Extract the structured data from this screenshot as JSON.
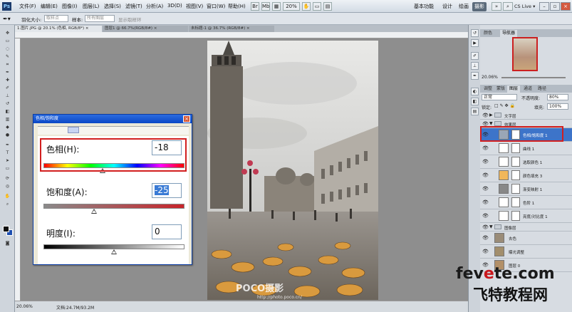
{
  "app": {
    "logo": "Ps"
  },
  "menu": [
    "文件(F)",
    "编辑(E)",
    "图像(I)",
    "图层(L)",
    "选择(S)",
    "滤镜(T)",
    "分析(A)",
    "3D(D)",
    "视图(V)",
    "窗口(W)",
    "帮助(H)"
  ],
  "menu_icons": [
    "Br",
    "Mb",
    "▦",
    "20%",
    "✋",
    "▭",
    "▤"
  ],
  "workspaces": [
    "基本功能",
    "设计",
    "绘画",
    "摄影"
  ],
  "cslive": "CS Live ▾",
  "options": {
    "feather_label": "羽化大小:",
    "feather_value": "取样点",
    "sample_label": "样本:",
    "sample_value": "所有图层",
    "show_ring": "显示取样环"
  },
  "tabs": [
    "1.图片.JPG @ 20.1% (色相, RGB/8*) ×",
    "图层1 @ 66.7%(RGB/8#) ×",
    "未标题-1 @ 36.7% (RGB/8#) ×"
  ],
  "status": {
    "zoom": "20.06%",
    "doc": "文档:24.7M/93.2M"
  },
  "photo": {
    "watermark": "POCO摄影",
    "watermark_url": "http://photo.poco.cn/"
  },
  "dialog": {
    "title": "色相/饱和度",
    "close": "×",
    "hue_label": "色相(H):",
    "hue_value": "-18",
    "sat_label": "饱和度(A):",
    "sat_value": "-25",
    "light_label": "明度(I):",
    "light_value": "0",
    "hue_pos": 0.42,
    "sat_pos": 0.36,
    "light_pos": 0.5
  },
  "right_tabs": {
    "top": [
      "颜色",
      "导航器"
    ],
    "mid": [
      "调整",
      "蒙版",
      "图层",
      "通道",
      "路径"
    ]
  },
  "navigator": {
    "zoom": "20.06%"
  },
  "layers_panel": {
    "blend_mode": "正常",
    "opacity_label": "不透明度:",
    "opacity_value": "80%",
    "lock_label": "锁定:",
    "fill_label": "填充:",
    "fill_value": "100%"
  },
  "layers": [
    {
      "name": "文字层",
      "type": "group"
    },
    {
      "name": "效果层",
      "type": "group"
    },
    {
      "name": "色相/饱和度 1",
      "type": "adj",
      "selected": true,
      "thumb_color": "#9aa6b6"
    },
    {
      "name": "曲线 1",
      "type": "adj",
      "thumb_color": "#ffffff"
    },
    {
      "name": "选取颜色 1",
      "type": "adj",
      "thumb_color": "#ffffff"
    },
    {
      "name": "颜色填充 3",
      "type": "adj",
      "thumb_color": "#f1b75a"
    },
    {
      "name": "渐变映射 1",
      "type": "adj",
      "thumb_color": "#888888"
    },
    {
      "name": "色阶 1",
      "type": "adj",
      "thumb_color": "#ffffff"
    },
    {
      "name": "亮度/对比度 1",
      "type": "adj",
      "thumb_color": "#ffffff"
    },
    {
      "name": "图像层",
      "type": "group"
    },
    {
      "name": "去色",
      "type": "img",
      "thumb_color": "#9a8c78"
    },
    {
      "name": "曝光调整",
      "type": "img",
      "thumb_color": "#a28e6c"
    },
    {
      "name": "图层 0",
      "type": "img",
      "thumb_color": "#b29068"
    }
  ],
  "site": {
    "logo_a": "fev",
    "logo_e": "e",
    "logo_b": "te.com",
    "sub": "飞特教程网"
  },
  "colors": {
    "accent_red": "#d21f1f",
    "dialog_title": "#0b48c6",
    "layer_selected": "#3d74c9"
  }
}
